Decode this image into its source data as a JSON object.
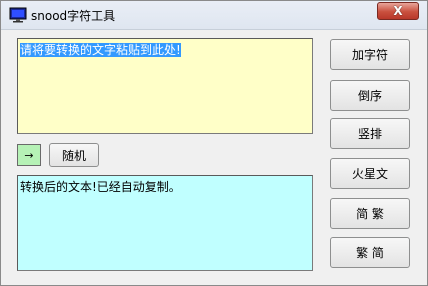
{
  "window": {
    "title": "snood字符工具",
    "close_label": "X"
  },
  "icons": {
    "app": "monitor-icon",
    "close": "close-icon"
  },
  "input": {
    "text": "请将要转换的文字粘贴到此处!"
  },
  "output": {
    "text": "转换后的文本!已经自动复制。"
  },
  "controls": {
    "arrow": "→",
    "random_label": "随机"
  },
  "side_buttons": [
    "加字符",
    "倒序",
    "竖排",
    "火星文",
    "简 繁",
    "繁 简"
  ],
  "colors": {
    "input_bg": "#ffffc8",
    "output_bg": "#c0ffff",
    "arrow_bg": "#b6f2b6",
    "selection": "#3399ff",
    "close": "#c9503e"
  }
}
